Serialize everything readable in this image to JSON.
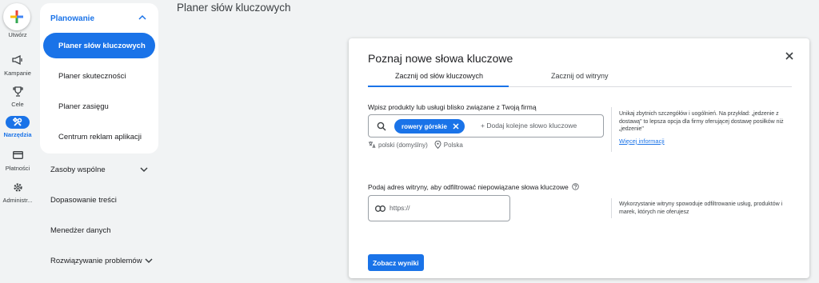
{
  "rail": {
    "create_label": "Utwórz",
    "items": [
      {
        "label": "Kampanie",
        "icon": "megaphone-icon"
      },
      {
        "label": "Cele",
        "icon": "trophy-icon"
      },
      {
        "label": "Narzędzia",
        "icon": "tools-icon",
        "active": true
      },
      {
        "label": "Płatności",
        "icon": "billing-card-icon"
      },
      {
        "label": "Administr...",
        "icon": "gear-icon"
      }
    ]
  },
  "nav": {
    "section_title": "Planowanie",
    "items": [
      {
        "label": "Planer słów kluczowych",
        "active": true
      },
      {
        "label": "Planer skuteczności"
      },
      {
        "label": "Planer zasięgu"
      },
      {
        "label": "Centrum reklam aplikacji"
      }
    ],
    "lower_items": [
      {
        "label": "Zasoby wspólne",
        "chevron": true
      },
      {
        "label": "Dopasowanie treści"
      },
      {
        "label": "Menedżer danych"
      },
      {
        "label": "Rozwiązywanie problemów",
        "chevron": true
      }
    ]
  },
  "page": {
    "title": "Planer słów kluczowych"
  },
  "modal": {
    "title": "Poznaj nowe słowa kluczowe",
    "tabs": [
      {
        "label": "Zacznij od słów kluczowych",
        "active": true
      },
      {
        "label": "Zacznij od witryny"
      }
    ],
    "keywords_label": "Wpisz produkty lub usługi blisko związane z Twoją firmą",
    "chip_label": "rowery górskie",
    "keyword_placeholder": "+ Dodaj kolejne słowo kluczowe",
    "language": "polski (domyślny)",
    "location": "Polska",
    "keywords_hint": "Unikaj zbytnich szczegółów i uogólnień. Na przykład: „jedzenie z dostawą\" to lepsza opcja dla firmy oferującej dostawę posiłków niż „jedzenie\"",
    "more_info_link": "Więcej informacji",
    "website_label": "Podaj adres witryny, aby odfiltrować niepowiązane słowa kluczowe",
    "url_placeholder": "https://",
    "website_hint": "Wykorzystanie witryny spowoduje odfiltrowanie usług, produktów i marek, których nie oferujesz",
    "submit_label": "Zobacz wyniki"
  },
  "colors": {
    "accent": "#1a73e8",
    "background": "#f1f3f4"
  }
}
